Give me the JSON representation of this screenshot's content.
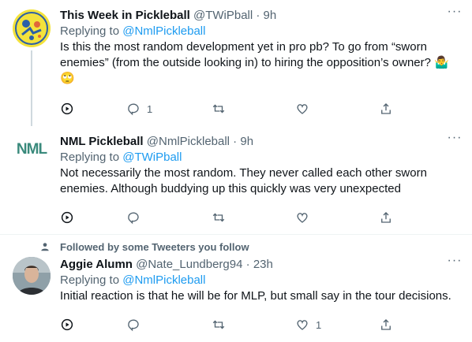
{
  "tweets": [
    {
      "name": "This Week in Pickleball",
      "handle": "@TWiPball",
      "time": "9h",
      "replying_prefix": "Replying to ",
      "replying_to": "@NmlPickleball",
      "text": "Is this the most random development yet in pro pb? To go from “sworn enemies” (from the outside looking in) to hiring the opposition’s owner? 🤷‍♂️ 🙄",
      "reply_count": "1",
      "retweet_count": "",
      "like_count": "",
      "avatar_icon": "pickleball-logo-avatar"
    },
    {
      "name": "NML Pickleball",
      "handle": "@NmlPickleball",
      "time": "9h",
      "replying_prefix": "Replying to ",
      "replying_to": "@TWiPball",
      "text": "Not necessarily the most random. They never called each other sworn enemies. Although buddying up this quickly was very unexpected",
      "reply_count": "",
      "retweet_count": "",
      "like_count": "",
      "avatar_text": "NML"
    },
    {
      "social_context": "Followed by some Tweeters you follow",
      "name": "Aggie Alumn",
      "handle": "@Nate_Lundberg94",
      "time": "23h",
      "replying_prefix": "Replying to ",
      "replying_to": "@NmlPickleball",
      "text": "Initial reaction is that he will be for MLP, but small say in the tour decisions.",
      "reply_count": "",
      "retweet_count": "",
      "like_count": "1",
      "avatar_icon": "person-photo-avatar"
    }
  ],
  "separator": " · ",
  "more_label": "···",
  "colors": {
    "link": "#1d9bf0",
    "muted": "#536471",
    "text": "#0f1419",
    "nml_green": "#2e8b57"
  }
}
